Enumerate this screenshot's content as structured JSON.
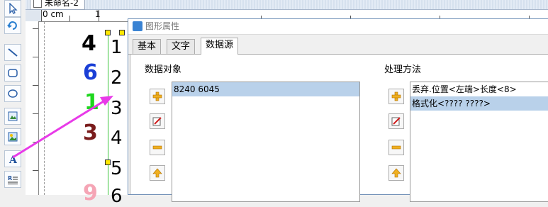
{
  "document_tab": {
    "label": "未命名-2"
  },
  "ruler": {
    "unit_label": "0 cm",
    "mark_1": "1"
  },
  "canvas": {
    "items": [
      {
        "text": "4",
        "color": "#000000"
      },
      {
        "text": "6",
        "color": "#1a3fd6"
      },
      {
        "text": "1",
        "color": "#1ed71e"
      },
      {
        "text": "3",
        "color": "#7a1c1c"
      },
      {
        "text": "9",
        "color": "#f5a5b5"
      }
    ],
    "column_values": [
      "1",
      "2",
      "3",
      "4",
      "5",
      "6"
    ],
    "arrow_color": "#e83ae8"
  },
  "toolbar": {
    "icons": [
      "pointer-icon",
      "rotate-icon",
      "line-icon",
      "rounded-rect-icon",
      "ellipse-icon",
      "image-icon",
      "picture-icon",
      "text-icon",
      "rich-text-icon"
    ]
  },
  "dialog": {
    "title": "图形属性",
    "tabs": [
      "基本",
      "文字",
      "数据源"
    ],
    "active_tab": "数据源",
    "data_object": {
      "label": "数据对象",
      "items": [
        "8240 6045"
      ]
    },
    "processing": {
      "label": "处理方法",
      "items": [
        "丢弃.位置<左端>长度<8>",
        "格式化<???? ????>"
      ],
      "selected_index": 1
    }
  }
}
